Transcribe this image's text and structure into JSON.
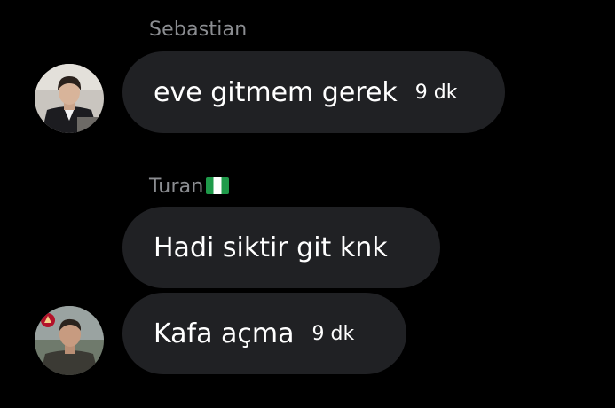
{
  "messages": [
    {
      "sender": "Sebastian",
      "text": "eve gitmem gerek",
      "time": "9 dk"
    },
    {
      "sender": "Turan",
      "sender_flag": "nigeria-flag",
      "bubbles": [
        {
          "text": "Hadi siktir git knk"
        },
        {
          "text": "Kafa açma",
          "time": "9 dk"
        }
      ]
    }
  ],
  "colors": {
    "background": "#000000",
    "bubble": "#202124",
    "sender_name": "#8b8d91",
    "text": "#ffffff"
  }
}
